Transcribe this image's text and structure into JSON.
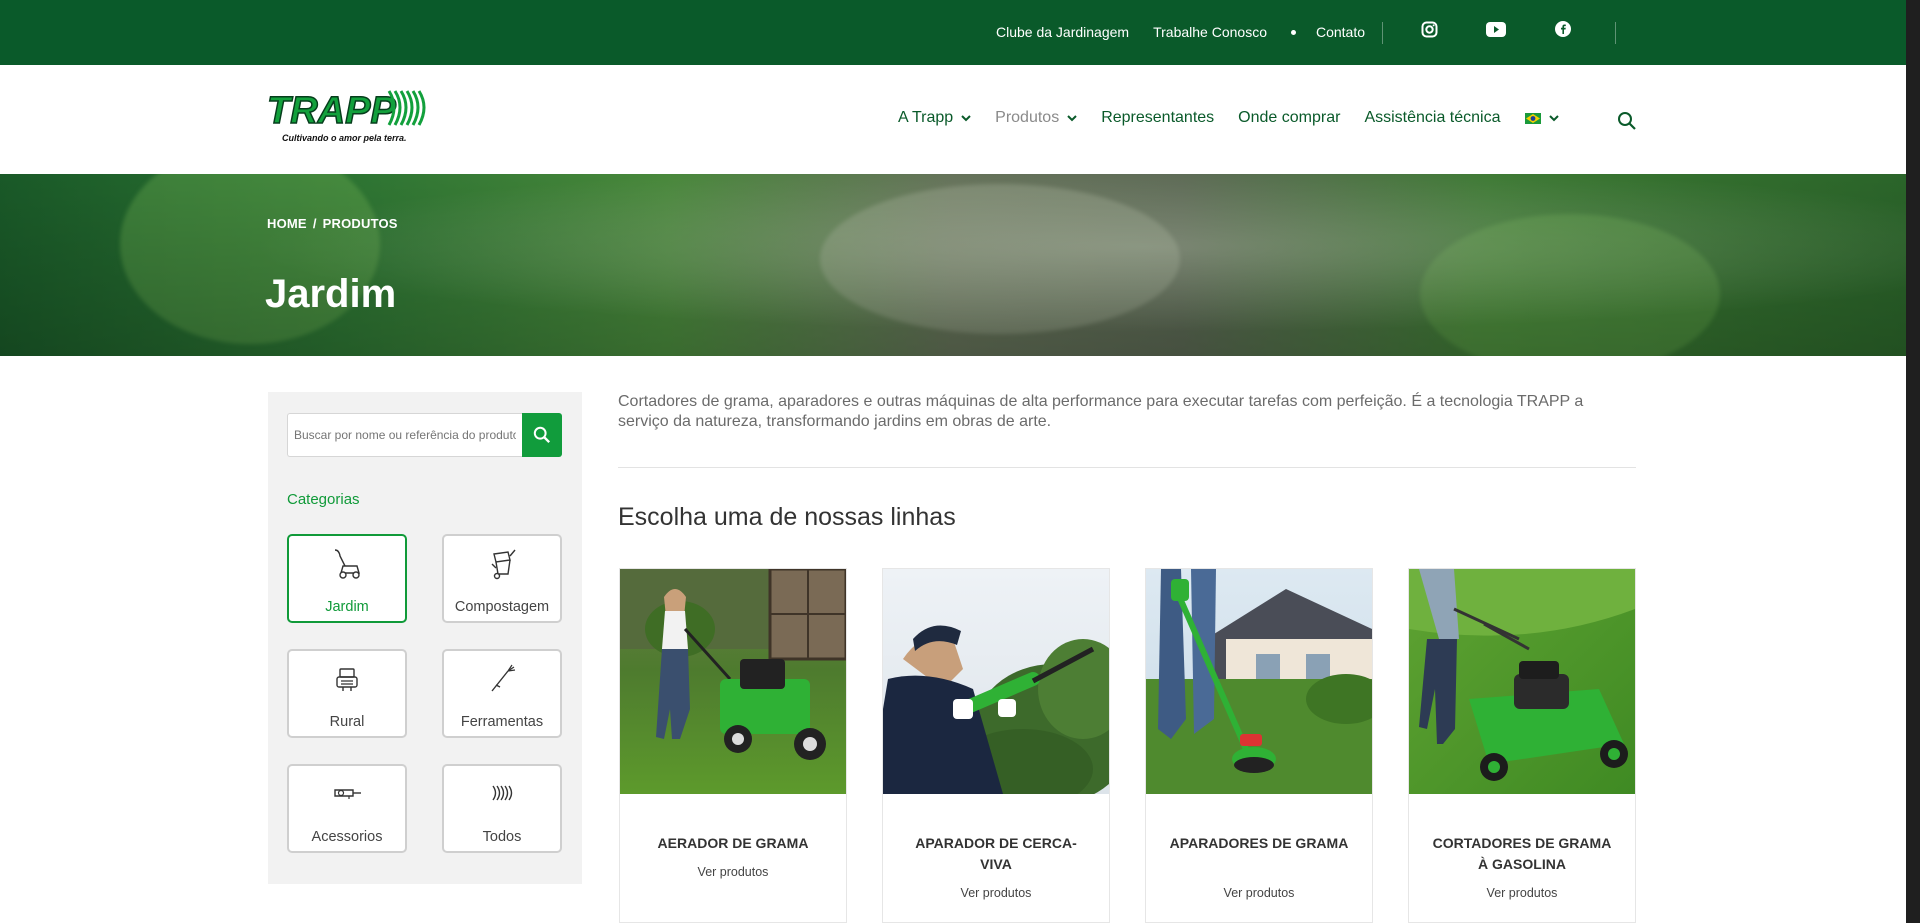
{
  "topbar": {
    "links": [
      "Clube da Jardinagem",
      "Trabalhe Conosco",
      "Contato"
    ],
    "social": [
      "instagram-icon",
      "youtube-icon",
      "facebook-icon"
    ]
  },
  "brand": {
    "name": "TRAPP",
    "tagline": "Cultivando o amor pela terra.",
    "green": "#0a5a2a",
    "accent": "#119c3c"
  },
  "nav": {
    "items": [
      {
        "label": "A Trapp",
        "dropdown": true
      },
      {
        "label": "Produtos",
        "dropdown": true
      },
      {
        "label": "Representantes",
        "dropdown": false
      },
      {
        "label": "Onde comprar",
        "dropdown": false
      },
      {
        "label": "Assistência técnica",
        "dropdown": false
      }
    ],
    "language_icon": "brazil-flag-icon"
  },
  "hero": {
    "breadcrumb": [
      "HOME",
      "PRODUTOS"
    ],
    "title": "Jardim"
  },
  "sidebar": {
    "search_placeholder": "Buscar por nome ou referência do produto",
    "categories_title": "Categorias",
    "categories": [
      {
        "label": "Jardim",
        "icon": "lawnmower-icon",
        "active": true
      },
      {
        "label": "Compostagem",
        "icon": "shredder-icon",
        "active": false
      },
      {
        "label": "Rural",
        "icon": "engine-icon",
        "active": false
      },
      {
        "label": "Ferramentas",
        "icon": "trimmer-icon",
        "active": false
      },
      {
        "label": "Acessorios",
        "icon": "accessory-icon",
        "active": false
      },
      {
        "label": "Todos",
        "icon": "trapp-waves-icon",
        "active": false
      }
    ]
  },
  "main": {
    "intro": "Cortadores de grama, aparadores e outras máquinas de alta performance para executar tarefas com perfeição. É a tecnologia TRAPP a serviço da natureza, transformando jardins em obras de arte.",
    "section_title": "Escolha uma de nossas linhas",
    "products": [
      {
        "name": "AERADOR DE GRAMA",
        "cta": "Ver produtos"
      },
      {
        "name": "APARADOR DE CERCA-VIVA",
        "cta": "Ver produtos"
      },
      {
        "name": "APARADORES DE GRAMA",
        "cta": "Ver produtos"
      },
      {
        "name": "CORTADORES DE GRAMA À GASOLINA",
        "cta": "Ver produtos"
      }
    ]
  }
}
